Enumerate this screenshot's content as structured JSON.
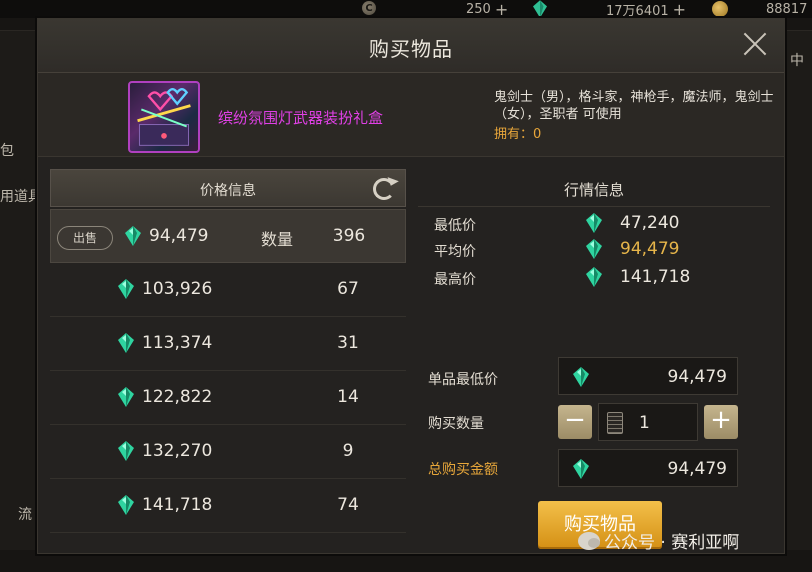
{
  "topbar": {
    "coin_symbol": "C",
    "coin_amount": "250",
    "gem_amount": "17万6401",
    "gold_amount": "88817",
    "plus": "+"
  },
  "modal": {
    "title": "购买物品",
    "item": {
      "name": "缤纷氛围灯武器装扮礼盒",
      "classes": "鬼剑士（男），格斗家，神枪手，魔法师，鬼剑士（女），圣职者 可使用",
      "owned": "拥有：0"
    }
  },
  "price_panel": {
    "header": "价格信息",
    "sell_badge": "出售",
    "qty_label": "数量",
    "rows": [
      {
        "price": "94,479",
        "qty": "396"
      },
      {
        "price": "103,926",
        "qty": "67"
      },
      {
        "price": "113,374",
        "qty": "31"
      },
      {
        "price": "122,822",
        "qty": "14"
      },
      {
        "price": "132,270",
        "qty": "9"
      },
      {
        "price": "141,718",
        "qty": "74"
      }
    ]
  },
  "market_panel": {
    "header": "行情信息",
    "min_label": "最低价",
    "min_value": "47,240",
    "avg_label": "平均价",
    "avg_value": "94,479",
    "max_label": "最高价",
    "max_value": "141,718"
  },
  "purchase": {
    "unit_min_label": "单品最低价",
    "unit_min_value": "94,479",
    "qty_label": "购买数量",
    "qty_value": "1",
    "minus": "−",
    "plus": "+",
    "total_label": "总购买金额",
    "total_value": "94,479",
    "buy_button": "购买物品"
  },
  "background": {
    "tab_fragment": "中",
    "left_fragment_1": "包",
    "left_fragment_2": "用道具",
    "left_fragment_3": "流"
  },
  "watermark": "公众号 · 赛利亚啊",
  "colors": {
    "accent_gold": "#e6a63a",
    "item_name": "#e040e6",
    "gem": "#2fd4a0"
  }
}
